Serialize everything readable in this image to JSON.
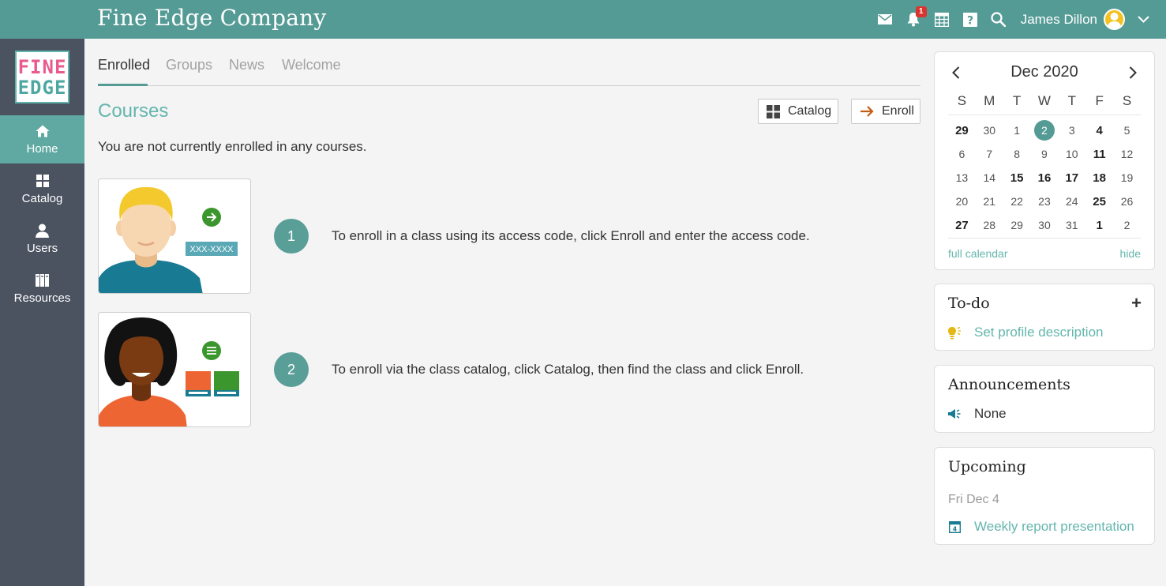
{
  "app": {
    "title": "Fine Edge Company"
  },
  "topbar": {
    "user_name": "James Dillon",
    "notifications_count": "1"
  },
  "logo": {
    "line1": "FINE",
    "line2": "EDGE"
  },
  "sidebar": {
    "items": [
      {
        "label": "Home",
        "icon": "home-icon"
      },
      {
        "label": "Catalog",
        "icon": "grid-icon"
      },
      {
        "label": "Users",
        "icon": "user-icon"
      },
      {
        "label": "Resources",
        "icon": "books-icon"
      }
    ]
  },
  "tabs": [
    {
      "label": "Enrolled"
    },
    {
      "label": "Groups"
    },
    {
      "label": "News"
    },
    {
      "label": "Welcome"
    }
  ],
  "courses": {
    "title": "Courses",
    "catalog_label": "Catalog",
    "enroll_label": "Enroll",
    "empty_message": "You are not currently enrolled in any courses.",
    "access_code_sample": "XXX-XXXX",
    "steps": [
      {
        "number": "1",
        "text": "To enroll in a class using its access code, click Enroll and enter the access code."
      },
      {
        "number": "2",
        "text": "To enroll via the class catalog, click Catalog, then find the class and click Enroll."
      }
    ]
  },
  "calendar": {
    "month_label": "Dec 2020",
    "weekdays": [
      "S",
      "M",
      "T",
      "W",
      "T",
      "F",
      "S"
    ],
    "weeks": [
      [
        "29",
        "30",
        "1",
        "2",
        "3",
        "4",
        "5"
      ],
      [
        "6",
        "7",
        "8",
        "9",
        "10",
        "11",
        "12"
      ],
      [
        "13",
        "14",
        "15",
        "16",
        "17",
        "18",
        "19"
      ],
      [
        "20",
        "21",
        "22",
        "23",
        "24",
        "25",
        "26"
      ],
      [
        "27",
        "28",
        "29",
        "30",
        "31",
        "1",
        "2"
      ]
    ],
    "bold_cells": [
      "0-0",
      "0-5",
      "1-5",
      "2-2",
      "2-3",
      "2-4",
      "2-5",
      "3-5",
      "4-0",
      "4-5"
    ],
    "today_cell": "0-3",
    "full_calendar_label": "full calendar",
    "hide_label": "hide"
  },
  "todo": {
    "title": "To-do",
    "add_label": "+",
    "item": "Set profile description"
  },
  "announcements": {
    "title": "Announcements",
    "item": "None"
  },
  "upcoming": {
    "title": "Upcoming",
    "date": "Fri Dec 4",
    "calendar_icon_day": "4",
    "event": "Weekly report presentation"
  },
  "colors": {
    "brand": "#559b95",
    "sidebar": "#4b5260",
    "accent_link": "#64b6ae",
    "alert": "#d9352e"
  }
}
